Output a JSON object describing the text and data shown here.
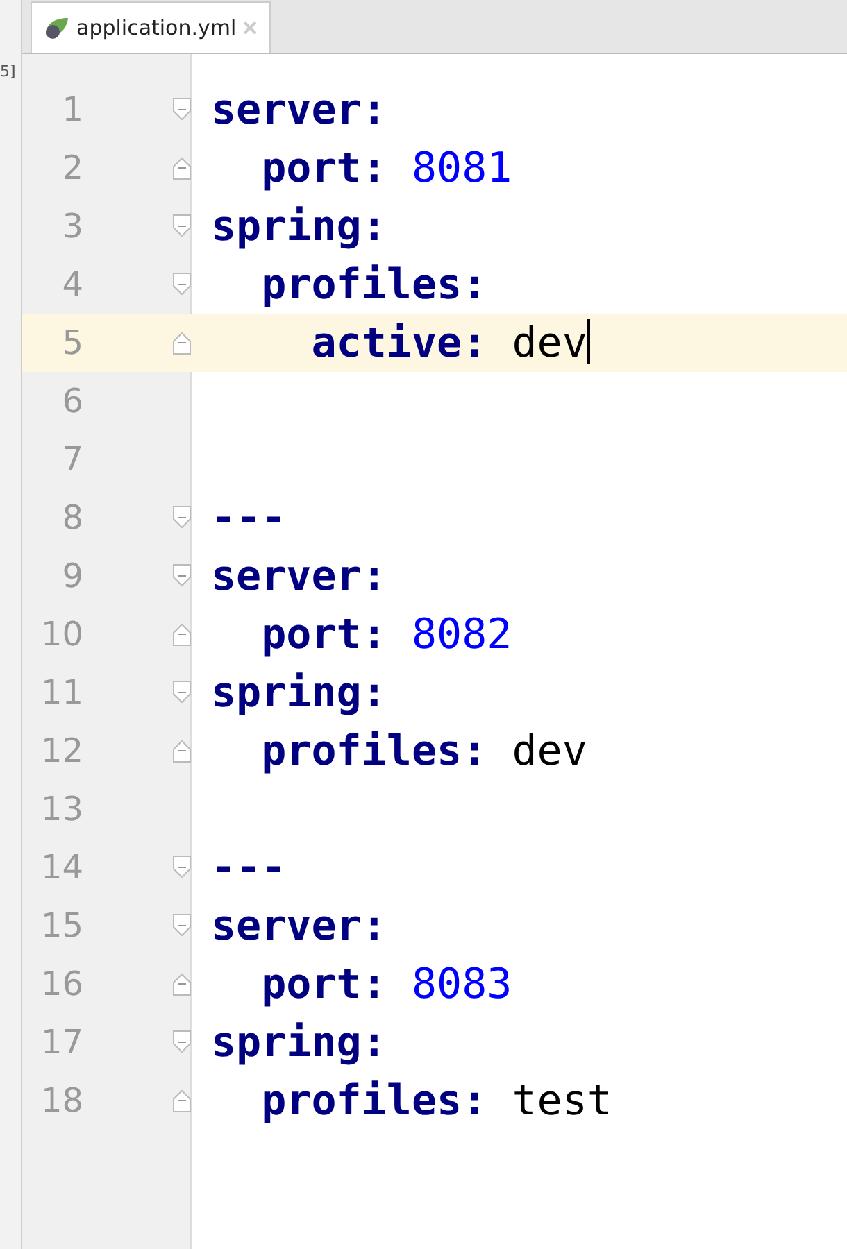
{
  "side_strip": {
    "text": "5]"
  },
  "tabs": [
    {
      "label": "application.yml",
      "selected": true
    }
  ],
  "lines": [
    {
      "number": "1",
      "fold_marker": {
        "kind": "start"
      },
      "current": false,
      "key": "server:"
    },
    {
      "number": "2",
      "fold_marker": {
        "kind": "end"
      },
      "current": false,
      "key": "  port:",
      "value": {
        "kind": "number",
        "text": "8081"
      }
    },
    {
      "number": "3",
      "fold_marker": {
        "kind": "start"
      },
      "current": false,
      "key": "spring:"
    },
    {
      "number": "4",
      "fold_marker": {
        "kind": "start"
      },
      "current": false,
      "key": "  profiles:"
    },
    {
      "number": "5",
      "fold_marker": {
        "kind": "end"
      },
      "current": true,
      "key": "    active:",
      "value": {
        "kind": "plain",
        "text": "dev"
      }
    },
    {
      "number": "6",
      "current": false
    },
    {
      "number": "7",
      "current": false
    },
    {
      "number": "8",
      "fold_marker": {
        "kind": "start"
      },
      "current": false,
      "plain": "---"
    },
    {
      "number": "9",
      "fold_marker": {
        "kind": "start"
      },
      "current": false,
      "key": "server:"
    },
    {
      "number": "10",
      "fold_marker": {
        "kind": "end"
      },
      "current": false,
      "key": "  port:",
      "value": {
        "kind": "number",
        "text": "8082"
      }
    },
    {
      "number": "11",
      "fold_marker": {
        "kind": "start"
      },
      "current": false,
      "key": "spring:"
    },
    {
      "number": "12",
      "fold_marker": {
        "kind": "end"
      },
      "current": false,
      "key": "  profiles:",
      "value": {
        "kind": "plain",
        "text": "dev"
      }
    },
    {
      "number": "13",
      "current": false
    },
    {
      "number": "14",
      "fold_marker": {
        "kind": "start"
      },
      "current": false,
      "plain": "---"
    },
    {
      "number": "15",
      "fold_marker": {
        "kind": "start"
      },
      "current": false,
      "key": "server:"
    },
    {
      "number": "16",
      "fold_marker": {
        "kind": "end"
      },
      "current": false,
      "key": "  port:",
      "value": {
        "kind": "number",
        "text": "8083"
      }
    },
    {
      "number": "17",
      "fold_marker": {
        "kind": "start"
      },
      "current": false,
      "key": "spring:"
    },
    {
      "number": "18",
      "fold_marker": {
        "kind": "end"
      },
      "current": false,
      "key": "  profiles:",
      "value": {
        "kind": "plain",
        "text": "test"
      }
    }
  ]
}
